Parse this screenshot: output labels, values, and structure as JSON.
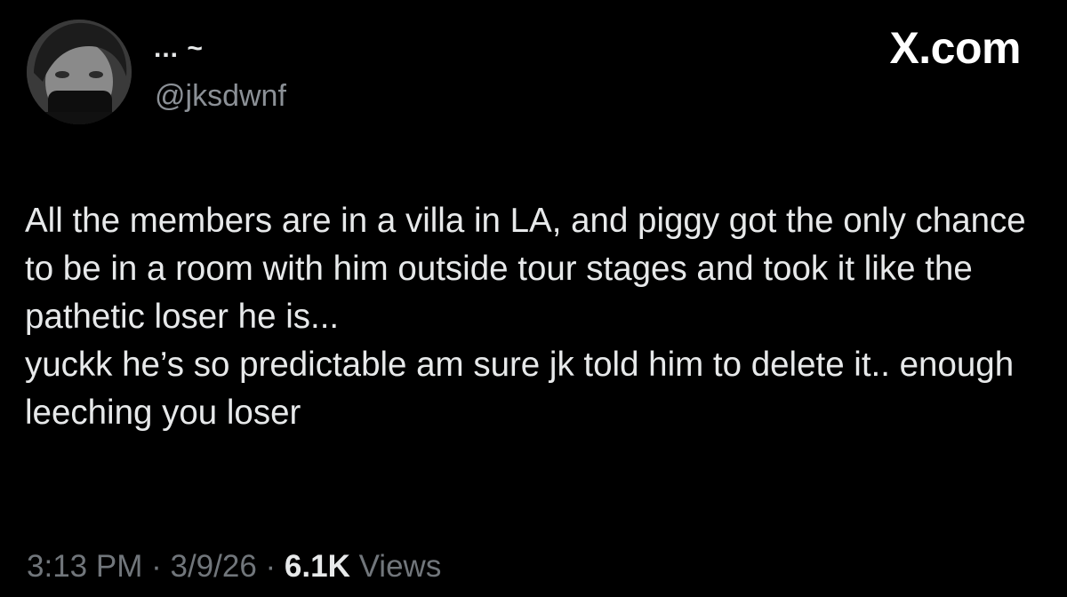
{
  "author": {
    "display_name": "... ~",
    "handle": "@jksdwnf"
  },
  "brand": "X.com",
  "tweet_text": "All the members are in a villa in LA, and piggy got the only chance to be in a room with him outside tour stages and took it like the pathetic loser he is...\nyuckk he’s so predictable am sure jk told him to delete it.. enough leeching you loser",
  "meta": {
    "time": "3:13 PM",
    "separator": "·",
    "date": "3/9/26",
    "views_count": "6.1K",
    "views_label": "Views"
  },
  "colors": {
    "background": "#000000",
    "text": "#e7e9ea",
    "muted": "#71767b"
  }
}
